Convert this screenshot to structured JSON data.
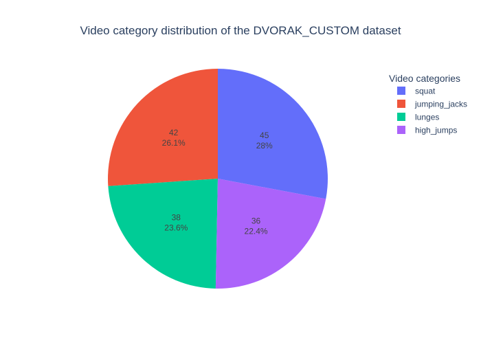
{
  "chart_data": {
    "type": "pie",
    "title": "Video category distribution of the DVORAK_CUSTOM dataset",
    "legend_title": "Video categories",
    "legend_position": "top-right",
    "direction": "counterclockwise",
    "slices": [
      {
        "label": "squat",
        "value": 45,
        "value_text": "45",
        "percent_text": "28%",
        "color": "#636efa"
      },
      {
        "label": "jumping_jacks",
        "value": 42,
        "value_text": "42",
        "percent_text": "26.1%",
        "color": "#EF553B"
      },
      {
        "label": "lunges",
        "value": 38,
        "value_text": "38",
        "percent_text": "23.6%",
        "color": "#00cc96"
      },
      {
        "label": "high_jumps",
        "value": 36,
        "value_text": "36",
        "percent_text": "22.4%",
        "color": "#ab63fa"
      }
    ]
  }
}
